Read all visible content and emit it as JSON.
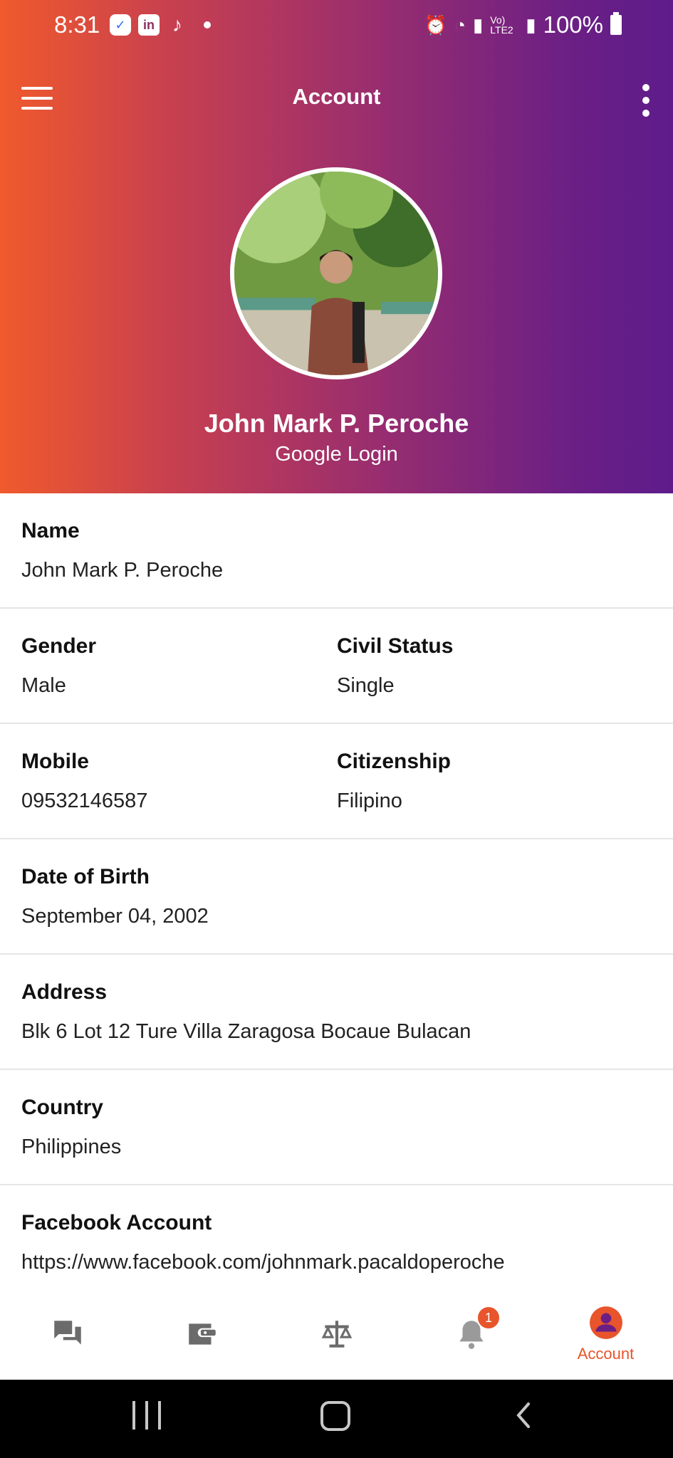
{
  "status_bar": {
    "time": "8:31",
    "battery": "100%",
    "network_label": "Vo) LTE2"
  },
  "app_bar": {
    "title": "Account",
    "menu_icon": "hamburger-menu-icon",
    "more_icon": "more-vert-icon"
  },
  "profile": {
    "name": "John Mark P. Peroche",
    "login_method": "Google Login"
  },
  "fields": {
    "name": {
      "label": "Name",
      "value": "John Mark P. Peroche"
    },
    "gender": {
      "label": "Gender",
      "value": "Male"
    },
    "civil_status": {
      "label": "Civil Status",
      "value": "Single"
    },
    "mobile": {
      "label": "Mobile",
      "value": "09532146587"
    },
    "citizenship": {
      "label": "Citizenship",
      "value": "Filipino"
    },
    "dob": {
      "label": "Date of Birth",
      "value": "September 04, 2002"
    },
    "address": {
      "label": "Address",
      "value": "Blk 6 Lot 12 Ture Villa Zaragosa Bocaue Bulacan"
    },
    "country": {
      "label": "Country",
      "value": "Philippines"
    },
    "facebook": {
      "label": "Facebook Account",
      "value": "https://www.facebook.com/johnmark.pacaldoperoche"
    }
  },
  "bottom_nav": {
    "items": [
      {
        "icon": "chat-icon",
        "label": ""
      },
      {
        "icon": "wallet-icon",
        "label": ""
      },
      {
        "icon": "scale-icon",
        "label": ""
      },
      {
        "icon": "notification-bell-icon",
        "label": "",
        "badge": "1"
      },
      {
        "icon": "account-icon",
        "label": "Account",
        "active": true
      }
    ]
  },
  "colors": {
    "accent": "#e8542b",
    "gradient_start": "#f05a2c",
    "gradient_end": "#5e1c8a",
    "nav_icon": "#6b6b6b"
  }
}
